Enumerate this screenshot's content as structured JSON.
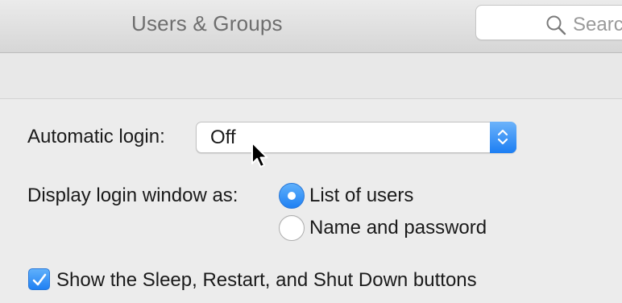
{
  "window": {
    "title": "Users & Groups"
  },
  "search": {
    "placeholder": "Search",
    "icon": "search-icon"
  },
  "login_options": {
    "automatic_login_label": "Automatic login:",
    "automatic_login_value": "Off",
    "display_label": "Display login window as:",
    "display_options": [
      {
        "label": "List of users",
        "selected": true
      },
      {
        "label": "Name and password",
        "selected": false
      }
    ],
    "show_buttons_label": "Show the Sleep, Restart, and Shut Down buttons",
    "show_buttons_checked": true
  },
  "colors": {
    "accent": "#1f80f3",
    "window_bg": "#ececec"
  }
}
